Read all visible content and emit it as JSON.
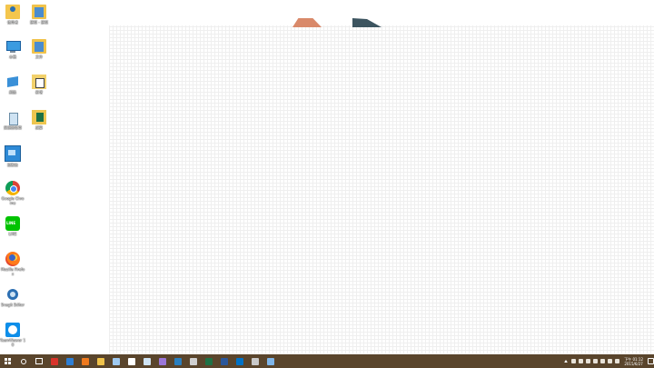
{
  "desktop": {
    "icons": [
      {
        "label": "使用者",
        "glyph": "user-icon"
      },
      {
        "label": "捷徑 - 捷徑",
        "glyph": "folder-icon"
      },
      {
        "label": "本機",
        "glyph": "pc-icon"
      },
      {
        "label": "文件",
        "glyph": "folder-icon"
      },
      {
        "label": "網路",
        "glyph": "network-icon"
      },
      {
        "label": "新增",
        "glyph": "document-icon"
      },
      {
        "label": "資源回收筒",
        "glyph": "recycle-bin-icon"
      },
      {
        "label": "試算",
        "glyph": "excel-icon"
      },
      {
        "label": "控制台",
        "glyph": "control-panel-icon"
      },
      {
        "label": "Google Chrome",
        "glyph": "chrome-icon"
      },
      {
        "label": "LINE",
        "glyph": "line-icon"
      },
      {
        "label": "Mozilla Firefox",
        "glyph": "firefox-icon"
      },
      {
        "label": "Snagit Editor",
        "glyph": "snagit-icon"
      },
      {
        "label": "TeamViewer 10",
        "glyph": "teamviewer-icon"
      }
    ]
  },
  "taskbar": {
    "color": "#5a452c",
    "pinned": [
      {
        "name": "start-button",
        "icon": "windows-icon",
        "color": "#ffffff"
      },
      {
        "name": "search-button",
        "icon": "search-icon",
        "color": "#ffffff"
      },
      {
        "name": "task-view-button",
        "icon": "task-view-icon",
        "color": "#ffffff"
      },
      {
        "name": "taskbar-app-acrobat",
        "icon": "acrobat-icon",
        "color": "#d9342b"
      },
      {
        "name": "taskbar-app-edge",
        "icon": "edge-icon",
        "color": "#2f7fd4"
      },
      {
        "name": "taskbar-app-firefox",
        "icon": "firefox-icon",
        "color": "#f07a1e"
      },
      {
        "name": "taskbar-app-explorer",
        "icon": "folder-icon",
        "color": "#f0c24a"
      },
      {
        "name": "taskbar-app-monitor",
        "icon": "monitor-icon",
        "color": "#9fc9ef"
      },
      {
        "name": "taskbar-app-store",
        "icon": "store-icon",
        "color": "#ffffff"
      },
      {
        "name": "taskbar-app-snagit",
        "icon": "snagit-icon",
        "color": "#cfe3f3"
      },
      {
        "name": "taskbar-app-visual-studio",
        "icon": "visual-studio-icon",
        "color": "#9b76d8"
      },
      {
        "name": "taskbar-app-sharpdevelop",
        "icon": "sharpdevelop-icon",
        "color": "#2a7fbf"
      },
      {
        "name": "taskbar-app-calculator",
        "icon": "calculator-icon",
        "color": "#d0d0d0"
      },
      {
        "name": "taskbar-app-excel",
        "icon": "excel-icon",
        "color": "#1e7145"
      },
      {
        "name": "taskbar-app-word",
        "icon": "word-icon",
        "color": "#2b579a"
      },
      {
        "name": "taskbar-app-outlook",
        "icon": "outlook-icon",
        "color": "#0072c6"
      },
      {
        "name": "taskbar-app-paint",
        "icon": "paint-icon",
        "color": "#c9c9c9"
      },
      {
        "name": "taskbar-app-photos",
        "icon": "photos-icon",
        "color": "#7fb5e8"
      }
    ],
    "tray": [
      "chevron-up-icon",
      "network-icon",
      "volume-icon",
      "keyboard-icon",
      "cloud-icon",
      "flag-icon",
      "ime-icon",
      "shield-icon"
    ],
    "clock": {
      "time": "下午 01:12",
      "date": "2015/6/27"
    }
  }
}
